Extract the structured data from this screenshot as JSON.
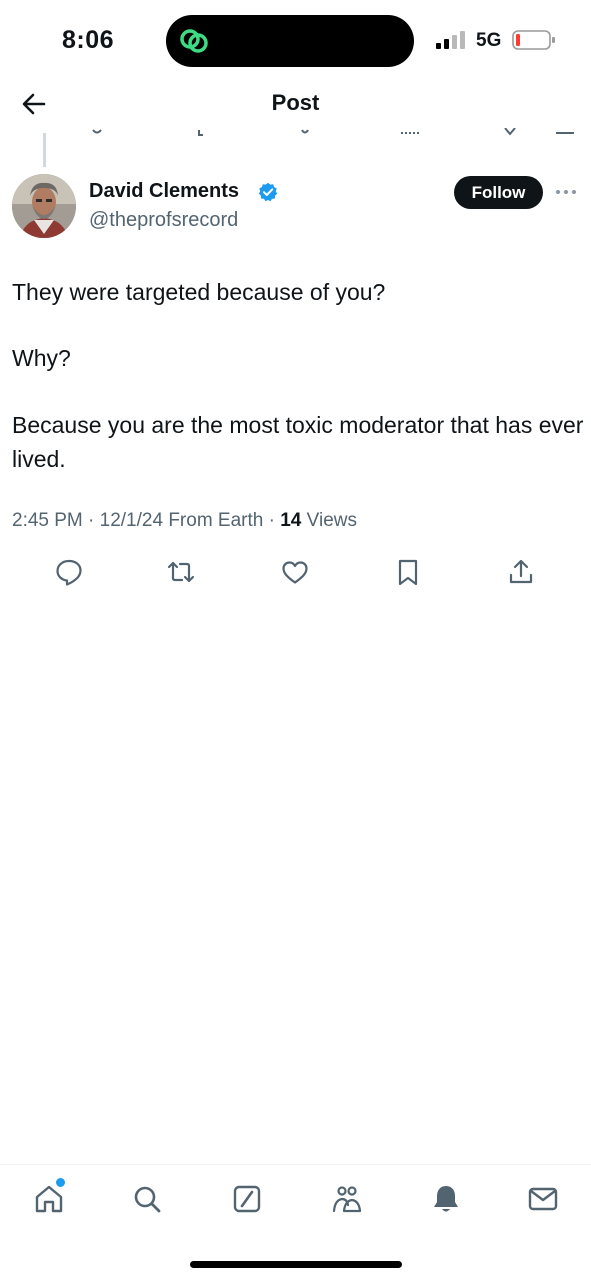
{
  "status_bar": {
    "time": "8:06",
    "network": "5G"
  },
  "header": {
    "title": "Post"
  },
  "post": {
    "author_name": "David Clements",
    "author_handle": "@theprofsrecord",
    "follow_label": "Follow",
    "paragraphs": [
      "They were targeted because of you?",
      "Why?",
      "Because you are the most toxic moderator that has ever lived."
    ],
    "timestamp": "2:45 PM · 12/1/24 From Earth ·",
    "views_count": "14",
    "views_label": "Views"
  },
  "actions": [
    "reply-icon",
    "repost-icon",
    "like-icon",
    "bookmark-icon",
    "share-icon"
  ],
  "bottom_nav": [
    "home-icon",
    "search-icon",
    "grok-icon",
    "communities-icon",
    "notifications-icon",
    "messages-icon"
  ],
  "colors": {
    "text": "#0f1419",
    "secondary": "#536471",
    "verified": "#1d9bf0",
    "accent_dot": "#1d9bf0",
    "island_icon": "#3ddc84"
  }
}
